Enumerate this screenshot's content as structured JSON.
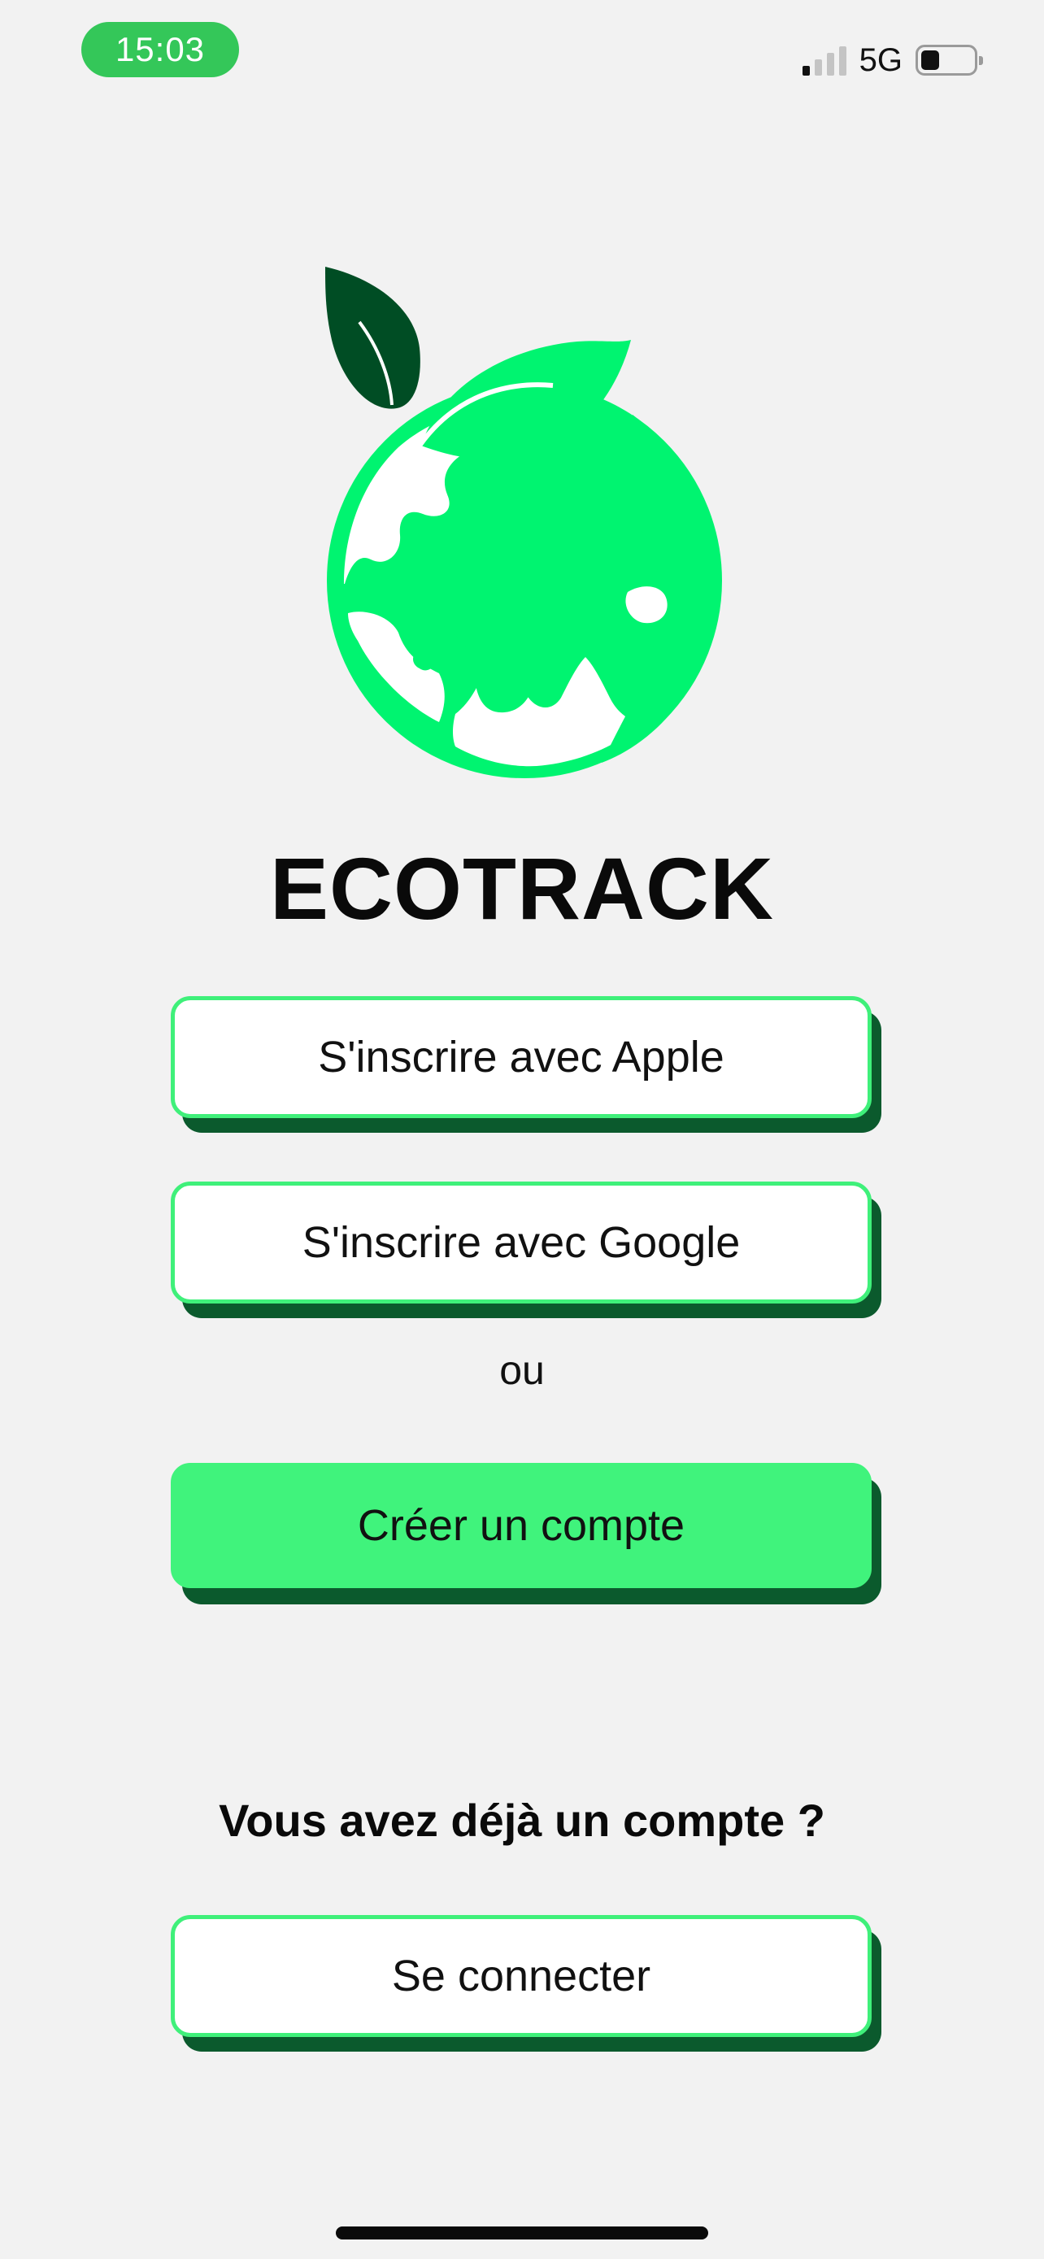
{
  "status_bar": {
    "time": "15:03",
    "network": "5G",
    "signal_bars_active": 1,
    "signal_bars_total": 4,
    "battery_level_fraction": 0.35
  },
  "app": {
    "title": "ECOTRACK",
    "logo_icon": "earth-with-leaves-icon"
  },
  "buttons": {
    "apple": "S'inscrire avec Apple",
    "google": "S'inscrire avec Google",
    "create_account": "Créer un compte",
    "login": "Se connecter"
  },
  "divider_text": "ou",
  "login_prompt": "Vous avez déjà un compte ?",
  "colors": {
    "accent_green": "#40f37c",
    "dark_green": "#0b5a2d",
    "leaf_dark": "#004d24",
    "status_green": "#34c759",
    "background": "#f2f2f2"
  }
}
